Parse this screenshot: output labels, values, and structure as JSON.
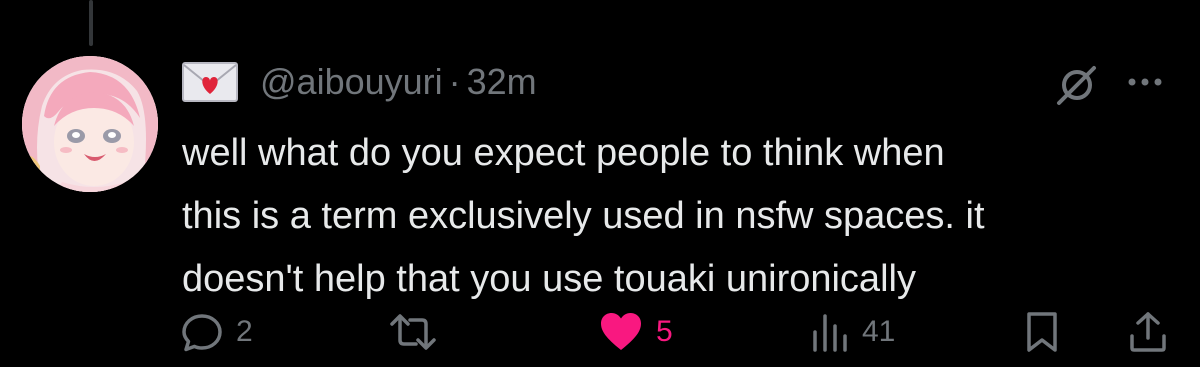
{
  "tweet": {
    "display_emoji": "💌",
    "handle": "@aibouyuri",
    "separator": "·",
    "time": "32m",
    "text": "well what do you expect people to think when\nthis is a term exclusively used in nsfw spaces. it\ndoesn't help that you use touaki unironically"
  },
  "actions": {
    "reply_count": "2",
    "retweet_count": "",
    "like_count": "5",
    "view_count": "41"
  },
  "colors": {
    "background": "#000000",
    "text": "#e7e9ea",
    "muted": "#71767b",
    "like": "#f91880"
  }
}
